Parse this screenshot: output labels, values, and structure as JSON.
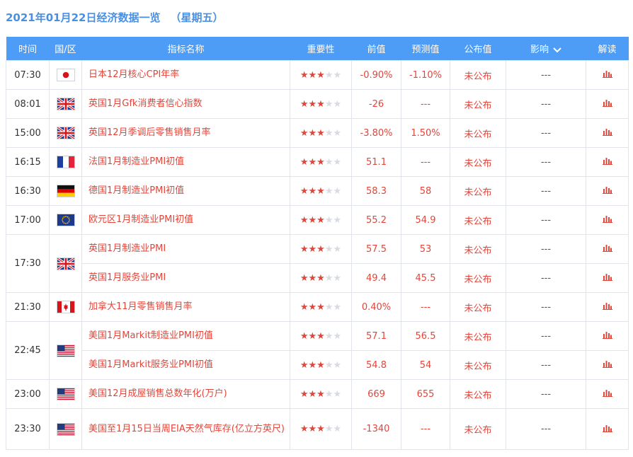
{
  "header": {
    "title": "2021年01月22日经济数据一览",
    "weekday": "（星期五）"
  },
  "columns": {
    "time": "时间",
    "country": "国/区",
    "indicator": "指标名称",
    "importance": "重要性",
    "previous": "前值",
    "forecast": "预测值",
    "actual": "公布值",
    "impact": "影响",
    "analysis": "解读"
  },
  "colors": {
    "accent": "#4d9cf6",
    "title": "#4a90e2",
    "value_red": "#e2453a",
    "star_off": "#d8dbe0"
  },
  "importance_max": 5,
  "groups": [
    {
      "time": "07:30",
      "flag": "jp",
      "rows": [
        {
          "indicator": "日本12月核心CPI年率",
          "importance": 3,
          "previous": "-0.90%",
          "forecast": "-1.10%",
          "actual": "未公布",
          "impact": "---"
        }
      ]
    },
    {
      "time": "08:01",
      "flag": "gb",
      "rows": [
        {
          "indicator": "英国1月Gfk消费者信心指数",
          "importance": 3,
          "previous": "-26",
          "forecast": "---",
          "actual": "未公布",
          "impact": "---"
        }
      ]
    },
    {
      "time": "15:00",
      "flag": "gb",
      "rows": [
        {
          "indicator": "英国12月季调后零售销售月率",
          "importance": 3,
          "previous": "-3.80%",
          "forecast": "1.50%",
          "actual": "未公布",
          "impact": "---"
        }
      ]
    },
    {
      "time": "16:15",
      "flag": "fr",
      "rows": [
        {
          "indicator": "法国1月制造业PMI初值",
          "importance": 3,
          "previous": "51.1",
          "forecast": "---",
          "actual": "未公布",
          "impact": "---"
        }
      ]
    },
    {
      "time": "16:30",
      "flag": "de",
      "rows": [
        {
          "indicator": "德国1月制造业PMI初值",
          "importance": 3,
          "previous": "58.3",
          "forecast": "58",
          "actual": "未公布",
          "impact": "---"
        }
      ]
    },
    {
      "time": "17:00",
      "flag": "eu",
      "rows": [
        {
          "indicator": "欧元区1月制造业PMI初值",
          "importance": 3,
          "previous": "55.2",
          "forecast": "54.9",
          "actual": "未公布",
          "impact": "---"
        }
      ]
    },
    {
      "time": "17:30",
      "flag": "gb",
      "rows": [
        {
          "indicator": "英国1月制造业PMI",
          "importance": 3,
          "previous": "57.5",
          "forecast": "53",
          "actual": "未公布",
          "impact": "---"
        },
        {
          "indicator": "英国1月服务业PMI",
          "importance": 3,
          "previous": "49.4",
          "forecast": "45.5",
          "actual": "未公布",
          "impact": "---"
        }
      ]
    },
    {
      "time": "21:30",
      "flag": "ca",
      "rows": [
        {
          "indicator": "加拿大11月零售销售月率",
          "importance": 3,
          "previous": "0.40%",
          "forecast": "---",
          "actual": "未公布",
          "impact": "---"
        }
      ]
    },
    {
      "time": "22:45",
      "flag": "us",
      "rows": [
        {
          "indicator": "美国1月Markit制造业PMI初值",
          "importance": 3,
          "previous": "57.1",
          "forecast": "56.5",
          "actual": "未公布",
          "impact": "---"
        },
        {
          "indicator": "美国1月Markit服务业PMI初值",
          "importance": 3,
          "previous": "54.8",
          "forecast": "54",
          "actual": "未公布",
          "impact": "---"
        }
      ]
    },
    {
      "time": "23:00",
      "flag": "us",
      "rows": [
        {
          "indicator": "美国12月成屋销售总数年化(万户)",
          "importance": 3,
          "previous": "669",
          "forecast": "655",
          "actual": "未公布",
          "impact": "---"
        }
      ]
    },
    {
      "time": "23:30",
      "flag": "us",
      "rows": [
        {
          "indicator": "美国至1月15日当周EIA天然气库存(亿立方英尺)",
          "importance": 3,
          "previous": "-1340",
          "forecast": "---",
          "actual": "未公布",
          "impact": "---"
        }
      ]
    }
  ]
}
